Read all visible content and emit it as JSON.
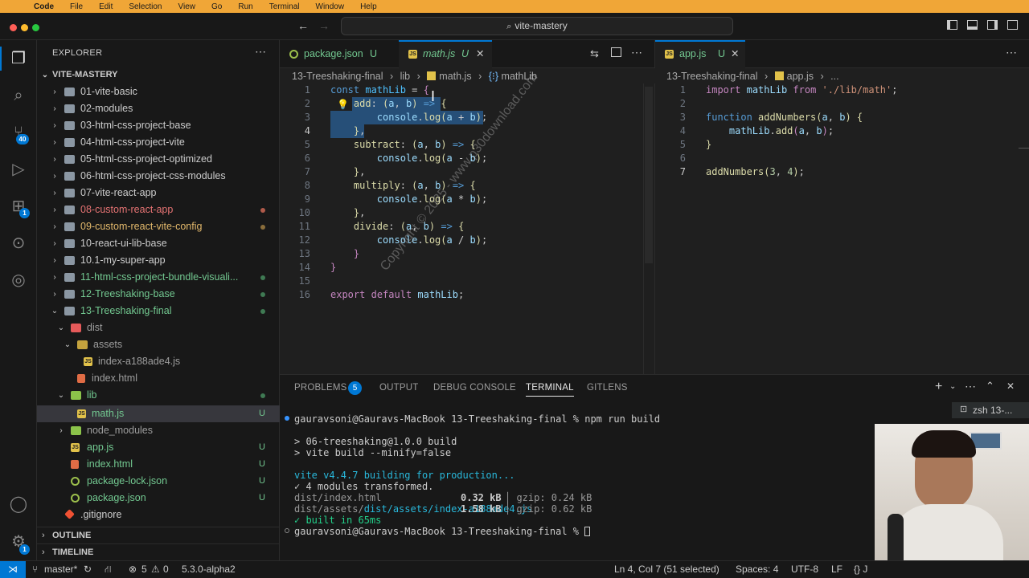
{
  "menubar": {
    "app": "Code",
    "items": [
      "File",
      "Edit",
      "Selection",
      "View",
      "Go",
      "Run",
      "Terminal",
      "Window",
      "Help"
    ]
  },
  "titlebar": {
    "search": "vite-mastery"
  },
  "activity": {
    "scm_badge": "40",
    "ext_badge": "1",
    "settings_badge": "1"
  },
  "explorer": {
    "header": "EXPLORER",
    "root": "VITE-MASTERY",
    "rows": [
      {
        "label": "01-vite-basic"
      },
      {
        "label": "02-modules"
      },
      {
        "label": "03-html-css-project-base"
      },
      {
        "label": "04-html-css-project-vite"
      },
      {
        "label": "05-html-css-project-optimized"
      },
      {
        "label": "06-html-css-project-css-modules"
      },
      {
        "label": "07-vite-react-app"
      },
      {
        "label": "08-custom-react-app"
      },
      {
        "label": "09-custom-react-vite-config"
      },
      {
        "label": "10-react-ui-lib-base"
      },
      {
        "label": "10.1-my-super-app"
      },
      {
        "label": "11-html-css-project-bundle-visuali..."
      },
      {
        "label": "12-Treeshaking-base"
      },
      {
        "label": "13-Treeshaking-final"
      },
      {
        "label": "dist"
      },
      {
        "label": "assets"
      },
      {
        "label": "index-a188ade4.js"
      },
      {
        "label": "index.html"
      },
      {
        "label": "lib"
      },
      {
        "label": "math.js",
        "status": "U"
      },
      {
        "label": "node_modules"
      },
      {
        "label": "app.js",
        "status": "U"
      },
      {
        "label": "index.html",
        "status": "U"
      },
      {
        "label": "package-lock.json",
        "status": "U"
      },
      {
        "label": "package.json",
        "status": "U"
      },
      {
        "label": ".gitignore"
      }
    ],
    "outline": "OUTLINE",
    "timeline": "TIMELINE"
  },
  "editor_left": {
    "tabs": [
      {
        "label": "package.json",
        "status": "U"
      },
      {
        "label": "math.js",
        "status": "U"
      }
    ],
    "breadcrumb": [
      "13-Treeshaking-final",
      "lib",
      "math.js",
      "mathLib"
    ],
    "line_numbers": [
      "1",
      "2",
      "3",
      "4",
      "5",
      "6",
      "7",
      "8",
      "9",
      "10",
      "11",
      "12",
      "13",
      "14",
      "15",
      "16"
    ]
  },
  "editor_right": {
    "tab": {
      "label": "app.js",
      "status": "U"
    },
    "breadcrumb": [
      "13-Treeshaking-final",
      "app.js",
      "..."
    ],
    "line_numbers": [
      "1",
      "2",
      "3",
      "4",
      "5",
      "6",
      "7"
    ]
  },
  "panel": {
    "tabs": [
      "PROBLEMS",
      "OUTPUT",
      "DEBUG CONSOLE",
      "TERMINAL",
      "GITLENS"
    ],
    "problems_count": "5",
    "shell": "zsh 13-...",
    "terminal": [
      "gauravsoni@Gauravs-MacBook 13-Treeshaking-final % npm run build",
      "> 06-treeshaking@1.0.0 build",
      "> vite build --minify=false",
      "vite v4.4.7 building for production...",
      "✓ 4 modules transformed.",
      "dist/index.html",
      "0.32 kB",
      "gzip: 0.24 kB",
      "dist/assets/index-a188ade4.js",
      "1.58 kB",
      "gzip: 0.62 kB",
      "✓ built in 65ms",
      "gauravsoni@Gauravs-MacBook 13-Treeshaking-final %"
    ]
  },
  "statusbar": {
    "branch": "master*",
    "errors": "5",
    "warnings": "0",
    "version": "5.3.0-alpha2",
    "position": "Ln 4, Col 7 (51 selected)",
    "spaces": "Spaces: 4",
    "encoding": "UTF-8",
    "eol": "LF",
    "lang": "{} J"
  },
  "watermark": "Copyright © 2025 - www.p30download.com",
  "webcam_label": "udemy"
}
